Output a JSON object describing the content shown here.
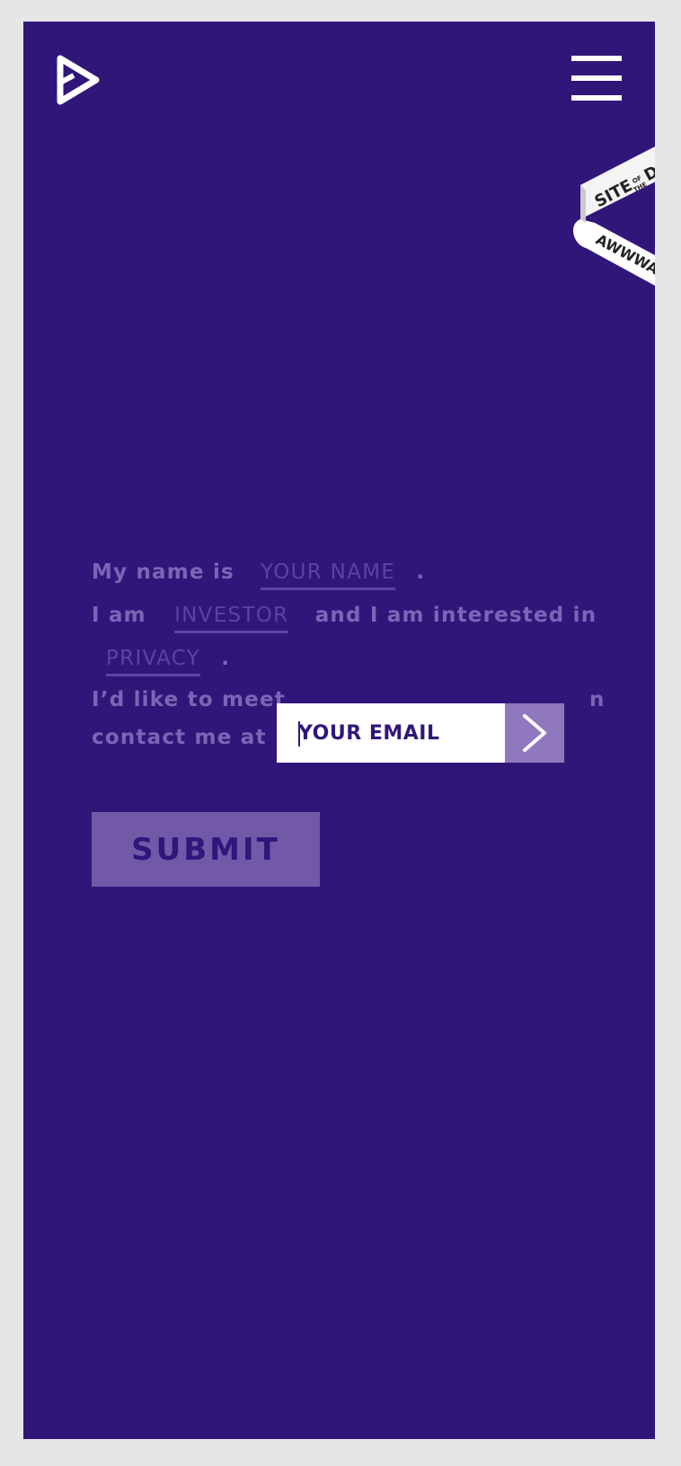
{
  "header": {
    "logo": "play-logo-icon",
    "menu_icon": "hamburger-menu-icon"
  },
  "badge": {
    "line1": "SITE",
    "of": "OF",
    "the": "THE",
    "day": "DAY",
    "brand": "AWWWARDS"
  },
  "form": {
    "line1_prefix": "My name is",
    "name_placeholder": "YOUR NAME",
    "line1_suffix": ".",
    "line2_prefix": "I am",
    "role_value": "INVESTOR",
    "line2_suffix": "and I am interested in",
    "interest_value": "PRIVACY",
    "line3_suffix": ".",
    "line4_left": "I’d like to meet",
    "line4_right": "n",
    "line5_prefix": "contact me at",
    "submit_label": "SUBMIT"
  },
  "email_popup": {
    "placeholder": "YOUR EMAIL",
    "go_icon": "chevron-right-icon"
  },
  "colors": {
    "background": "#31167a",
    "frame": "#e6e6e6",
    "muted_text": "#7c65b7",
    "submit_bg": "#7159a8",
    "accent": "#8f78bd"
  }
}
